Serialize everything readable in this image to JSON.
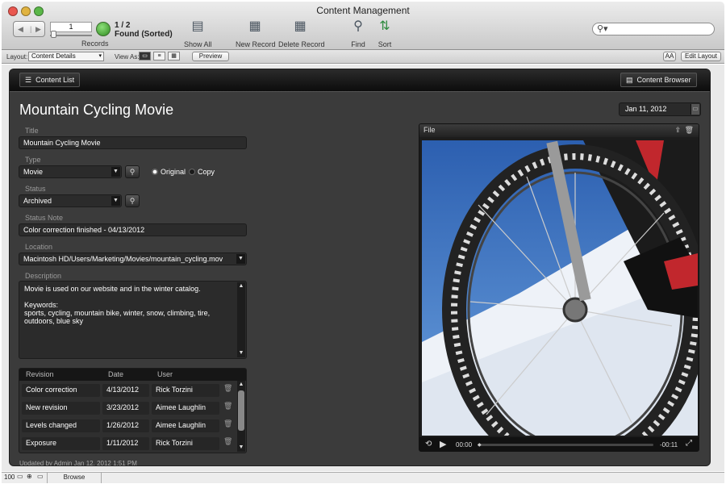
{
  "window": {
    "title": "Content Management"
  },
  "toolbar": {
    "record_input": "1",
    "records_count": "1 / 2",
    "records_status": "Found (Sorted)",
    "records_label": "Records",
    "show_all": "Show All",
    "new_record": "New Record",
    "delete_record": "Delete Record",
    "find": "Find",
    "sort": "Sort",
    "search_placeholder": ""
  },
  "layoutbar": {
    "layout_label": "Layout:",
    "layout_value": "Content Details",
    "view_as_label": "View As:",
    "preview": "Preview",
    "text_size": "AA",
    "edit_layout": "Edit Layout"
  },
  "header": {
    "content_list": "Content List",
    "content_browser": "Content Browser"
  },
  "record": {
    "title_heading": "Mountain Cycling Movie",
    "date": "Jan 11, 2012",
    "labels": {
      "title": "Title",
      "type": "Type",
      "status": "Status",
      "status_note": "Status Note",
      "location": "Location",
      "description": "Description"
    },
    "title": "Mountain Cycling Movie",
    "type": "Movie",
    "type_options": {
      "original": "Original",
      "copy": "Copy",
      "selected": "Original"
    },
    "status": "Archived",
    "status_note": "Color correction finished - 04/13/2012",
    "location": "Macintosh HD/Users/Marketing/Movies/mountain_cycling.mov",
    "description_line1": "Movie is used on our website and  in the winter catalog.",
    "description_line2": "Keywords:",
    "description_line3": "sports, cycling, mountain bike, winter, snow, climbing, tire,",
    "description_line4": "outdoors, blue sky",
    "revision_headers": [
      "Revision",
      "Date",
      "User"
    ],
    "revisions": [
      {
        "revision": "Color correction",
        "date": "4/13/2012",
        "user": "Rick Torzini"
      },
      {
        "revision": "New revision",
        "date": "3/23/2012",
        "user": "Aimee Laughlin"
      },
      {
        "revision": "Levels changed",
        "date": "1/26/2012",
        "user": "Aimee Laughlin"
      },
      {
        "revision": "Exposure",
        "date": "1/11/2012",
        "user": "Rick Torzini"
      }
    ],
    "updated": "Updated by Admin Jan 12, 2012 1:51 PM"
  },
  "media": {
    "label": "File",
    "time_current": "00:00",
    "time_remaining": "-00:11",
    "progress": 0
  },
  "statusbar": {
    "zoom": "100",
    "mode": "Browse"
  },
  "colors": {
    "panel_bg": "#3b3b3b",
    "field_bg": "#2b2b2b",
    "sky": "#3d76c4",
    "snow": "#eef2f8"
  }
}
